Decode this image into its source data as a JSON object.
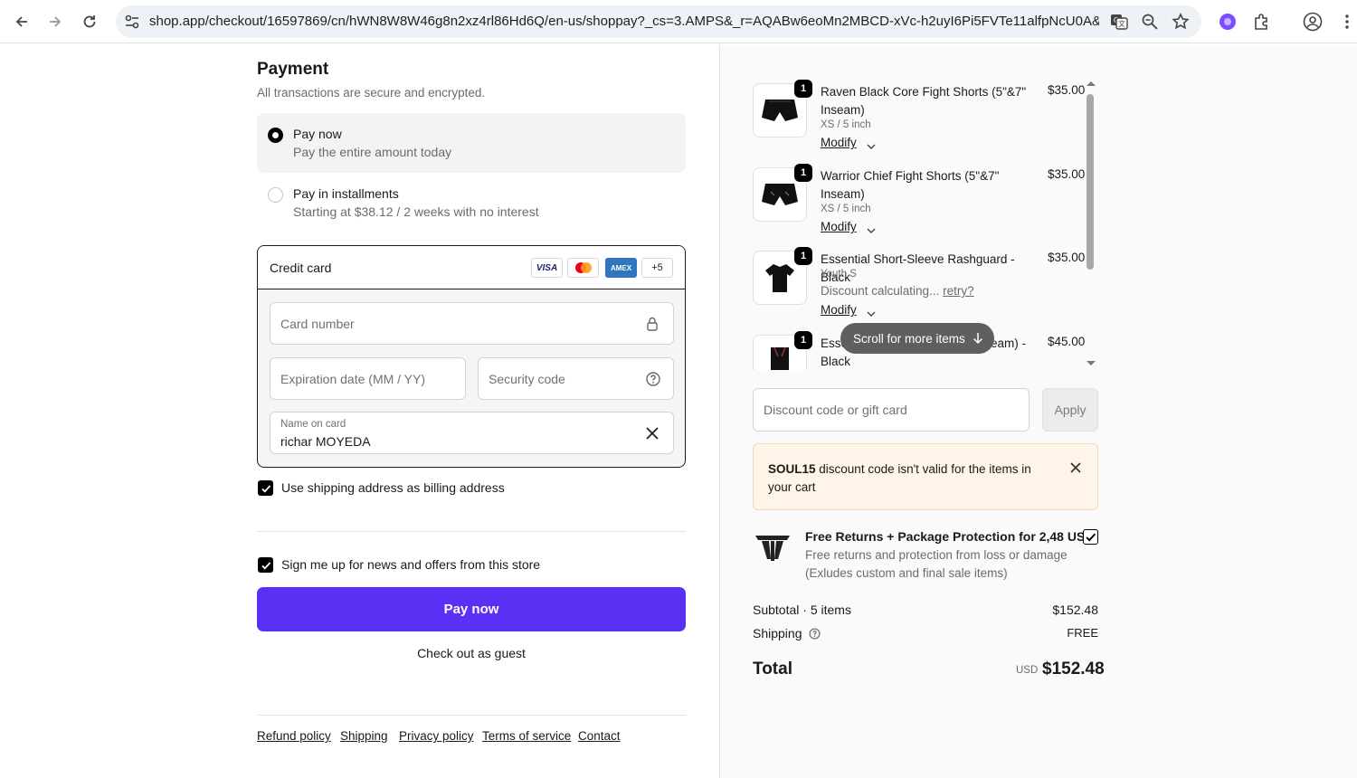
{
  "browser": {
    "url": "shop.app/checkout/16597869/cn/hWN8W8W46g8n2xz4rl86Hd6Q/en-us/shoppay?_cs=3.AMPS&_r=AQABw6eoMn2MBCD-xVc-h2uyI6Pi5FVTe11alfpNcU0A&re..."
  },
  "payment": {
    "title": "Payment",
    "subtitle": "All transactions are secure and encrypted.",
    "options": [
      {
        "label": "Pay now",
        "desc": "Pay the entire amount today",
        "selected": true
      },
      {
        "label": "Pay in installments",
        "desc": "Starting at $38.12 / 2 weeks with no interest",
        "selected": false
      }
    ],
    "credit_card": {
      "label": "Credit card",
      "brands": [
        "VISA",
        "Mastercard",
        "AMEX",
        "+5"
      ],
      "card_number_placeholder": "Card number",
      "expiration_placeholder": "Expiration date (MM / YY)",
      "security_placeholder": "Security code",
      "name_label": "Name on card",
      "name_value": "richar MOYEDA"
    },
    "billing_checkbox": {
      "label": "Use shipping address as billing address",
      "checked": true
    },
    "news_checkbox": {
      "label": "Sign me up for news and offers from this store",
      "checked": true
    },
    "pay_button": "Pay now",
    "guest_link": "Check out as guest",
    "footer_links": [
      "Refund policy",
      "Shipping",
      "Privacy policy",
      "Terms of service",
      "Contact"
    ]
  },
  "summary": {
    "items": [
      {
        "qty": "1",
        "name": "Raven Black Core Fight Shorts (5\"&7\" Inseam)",
        "variant": "XS / 5 inch",
        "price": "$35.00",
        "modify": "Modify"
      },
      {
        "qty": "1",
        "name": "Warrior Chief Fight Shorts (5\"&7\" Inseam)",
        "variant": "XS / 5 inch",
        "price": "$35.00",
        "modify": "Modify"
      },
      {
        "qty": "1",
        "name": "Essential Short-Sleeve Rashguard - Black",
        "variant": "Youth S",
        "discount_text": "Discount calculating...",
        "retry": "retry?",
        "price": "$35.00",
        "modify": "Modify"
      },
      {
        "qty": "1",
        "name_start": "Esse",
        "name_end": "eam) -",
        "name_line2": "Black",
        "price": "$45.00"
      }
    ],
    "scroll_hint": "Scroll for more items",
    "discount_placeholder": "Discount code or gift card",
    "apply_button": "Apply",
    "alert": {
      "code": "SOUL15",
      "message": " discount code isn't valid for the items in your cart"
    },
    "protection": {
      "title": "Free Returns + Package Protection for 2,48 US$",
      "desc": "Free returns and protection from loss or damage (Exludes custom and final sale items)",
      "checked": true
    },
    "subtotal_label": "Subtotal · 5 items",
    "subtotal_value": "$152.48",
    "shipping_label": "Shipping",
    "shipping_value": "FREE",
    "total_label": "Total",
    "total_currency": "USD",
    "total_value": "$152.48"
  },
  "colors": {
    "primary_button": "#5a31f4",
    "alert_bg": "#fff4e8"
  }
}
